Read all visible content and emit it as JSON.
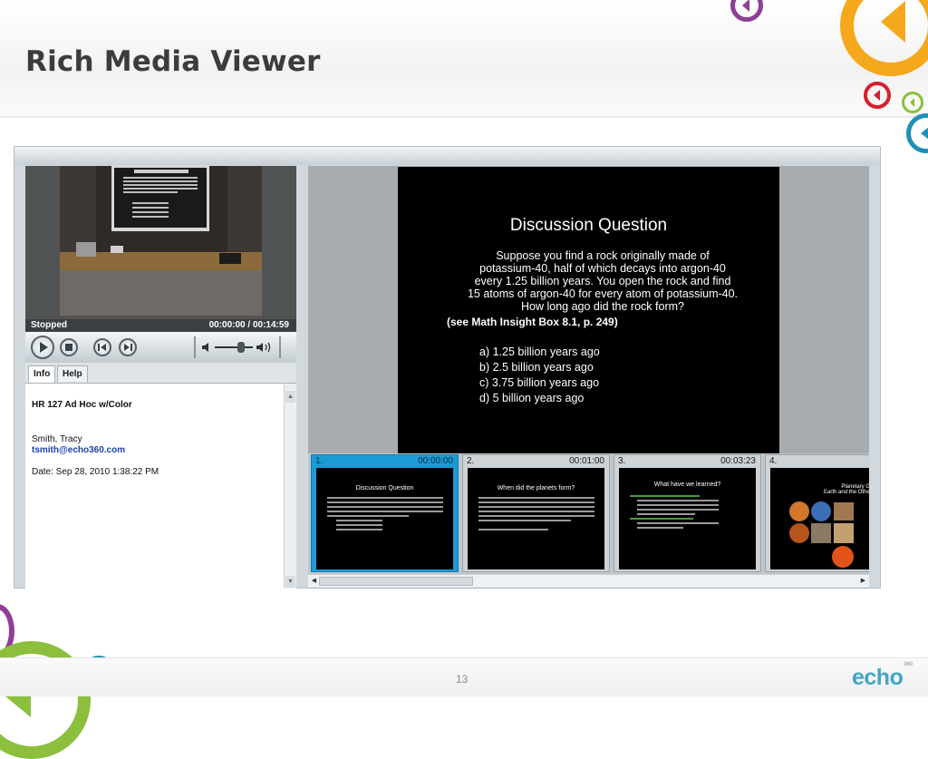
{
  "slide": {
    "title": "Rich Media Viewer",
    "page_number": "13",
    "logo": "echo",
    "logo_superscript": "360"
  },
  "player": {
    "status": "Stopped",
    "time": "00:00:00 / 00:14:59",
    "controls": [
      "play-icon",
      "stop-icon",
      "previous-icon",
      "next-icon",
      "volume-icon"
    ],
    "volume_level": 0.6
  },
  "tabs": [
    {
      "label": "Info",
      "active": true
    },
    {
      "label": "Help",
      "active": false
    }
  ],
  "info": {
    "title": "HR 127 Ad Hoc w/Color",
    "name": "Smith, Tracy",
    "email": "tsmith@echo360.com",
    "date": "Date: Sep 28, 2010 1:38:22 PM"
  },
  "main_slide": {
    "title": "Discussion Question",
    "question": "Suppose you find a rock originally made of potassium-40, half of which decays into argon-40 every 1.25 billion years. You open the rock and find 15 atoms of argon-40 for every atom of potassium-40. How long ago did the rock form?",
    "reference": "(see Math Insight Box 8.1, p. 249)",
    "answers": [
      "a)  1.25 billion years ago",
      "b)  2.5 billion years ago",
      "c)  3.75 billion years ago",
      "d)  5 billion years ago"
    ]
  },
  "thumbnails": [
    {
      "number": "1.",
      "time": "00:00:00",
      "title": "Discussion Question",
      "selected": true
    },
    {
      "number": "2.",
      "time": "00:01:00",
      "title": "When did the planets form?",
      "selected": false
    },
    {
      "number": "3.",
      "time": "00:03:23",
      "title": "What have we learned?",
      "selected": false
    },
    {
      "number": "4.",
      "time": "",
      "title": "Planetary Geology\nEarth and the Other Terrestrial W",
      "selected": false
    }
  ],
  "colors": {
    "accent_blue": "#1c9ad6",
    "deco_orange": "#f5a81c",
    "deco_purple": "#8e3f96",
    "deco_red": "#d81e2c",
    "deco_green": "#8bbf3c",
    "deco_teal": "#1e90b8"
  }
}
